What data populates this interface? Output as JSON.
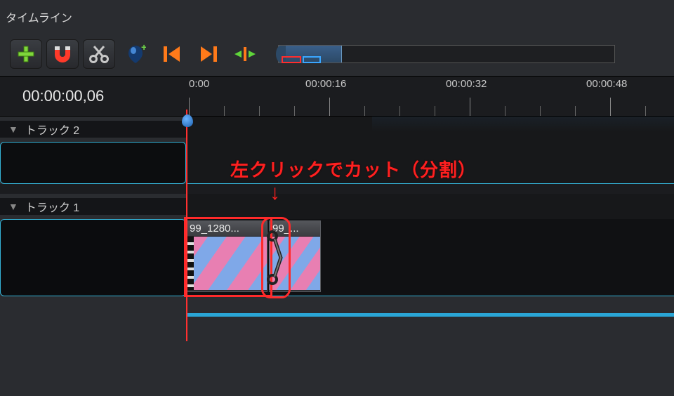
{
  "panel": {
    "title": "タイムライン"
  },
  "timecode": "00:00:00,06",
  "ruler": {
    "labels": [
      "0:00",
      "00:00:16",
      "00:00:32",
      "00:00:48"
    ]
  },
  "tracks": {
    "t2": {
      "name": "トラック 2"
    },
    "t1": {
      "name": "トラック 1"
    }
  },
  "clips": {
    "c1": {
      "label": "99_1280..."
    },
    "c2": {
      "label": "99_..."
    }
  },
  "annotation": {
    "text": "左クリックでカット（分割）",
    "arrow": "↓"
  },
  "icons": {
    "add": "plus-icon",
    "magnet": "magnet-icon",
    "cut": "scissors-icon",
    "marker": "marker-icon",
    "prev": "prev-key-icon",
    "next": "next-key-icon",
    "split": "ripple-icon"
  }
}
